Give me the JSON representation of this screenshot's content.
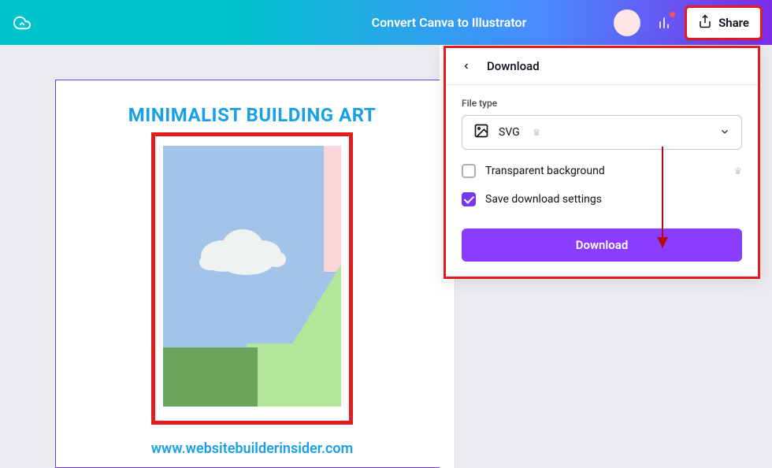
{
  "header": {
    "title": "Convert Canva to Illustrator",
    "share_label": "Share"
  },
  "canvas": {
    "title": "MINIMALIST BUILDING ART",
    "footer_url": "www.websitebuilderinsider.com"
  },
  "download_panel": {
    "title": "Download",
    "file_type_label": "File type",
    "file_type_value": "SVG",
    "transparent_label": "Transparent background",
    "transparent_checked": false,
    "save_settings_label": "Save download settings",
    "save_settings_checked": true,
    "download_button": "Download"
  },
  "icons": {
    "cloud": "cloud-save-icon",
    "analytics": "bar-chart-icon",
    "share": "share-upload-icon",
    "back": "chevron-left-icon",
    "image": "image-icon",
    "crown": "crown-icon",
    "chevron_down": "chevron-down-icon"
  },
  "colors": {
    "accent_purple": "#8b3dff",
    "highlight_red": "#e11c1c",
    "header_gradient_start": "#00c4cc",
    "header_gradient_end": "#7d2ae8",
    "link_blue": "#19a0e6"
  }
}
